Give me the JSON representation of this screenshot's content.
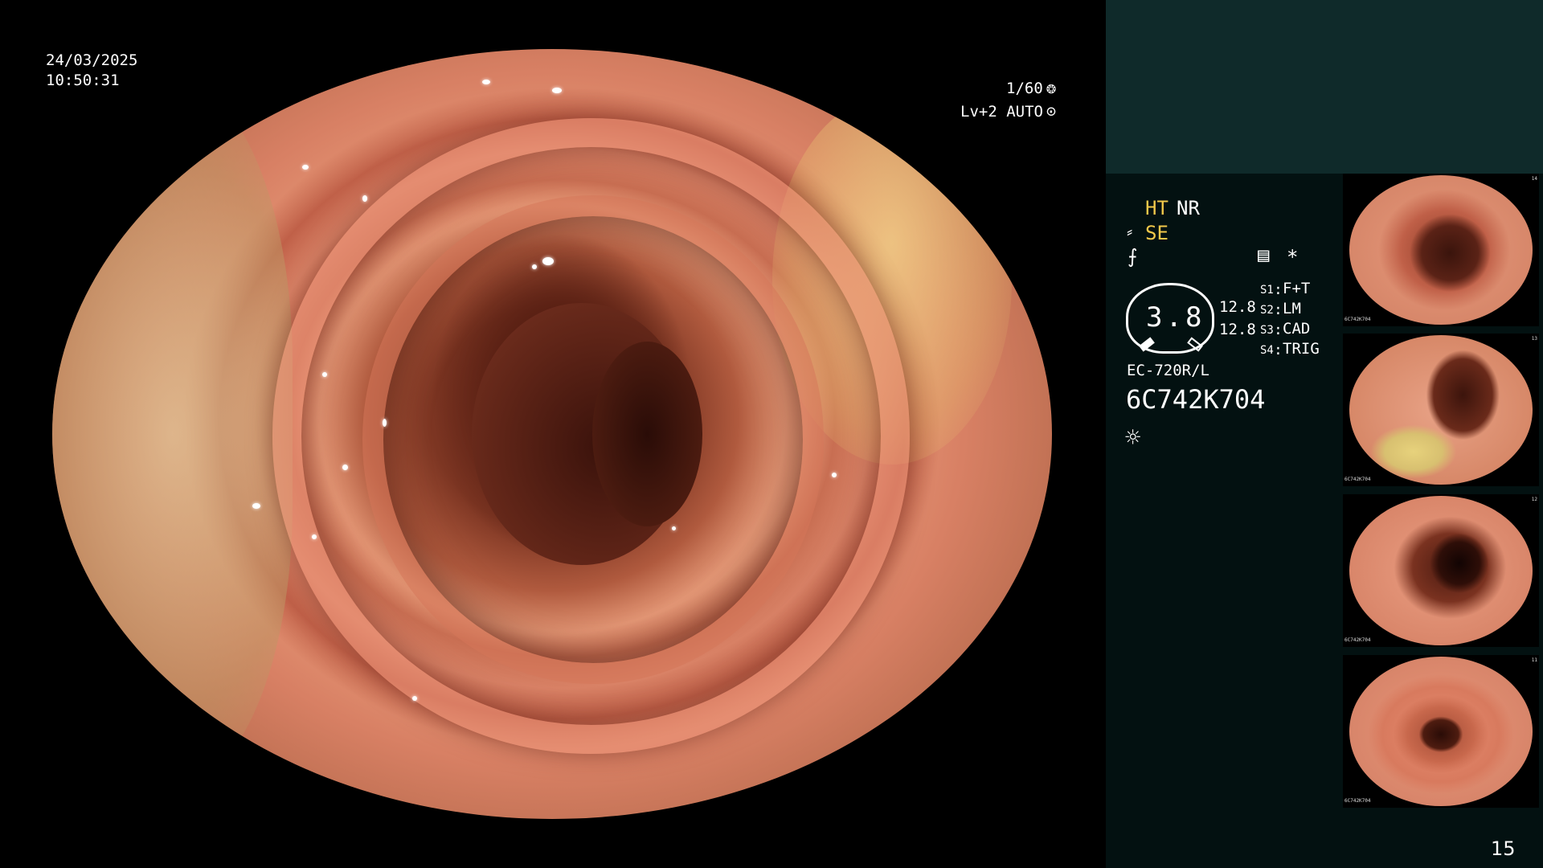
{
  "overlay": {
    "date": "24/03/2025",
    "time": "10:50:31",
    "shutter": "1/60",
    "shutter_icon": "❂",
    "level": "Lv+2 AUTO",
    "auto_icon": "⊙"
  },
  "status": {
    "ht": "HT",
    "nr": "NR",
    "se_icon": "⸗",
    "se": "SE",
    "f_icon": "⨍",
    "memo_icon": "▤",
    "asterisk": "*",
    "gauge_value": "3.8",
    "value_a": "12.8",
    "value_b": "12.8",
    "switches": [
      {
        "key": "S1",
        "value": "F+T"
      },
      {
        "key": "S2",
        "value": "LM"
      },
      {
        "key": "S3",
        "value": "CAD"
      },
      {
        "key": "S4",
        "value": "TRIG"
      }
    ],
    "scope_model": "EC-720R/L",
    "scope_serial": "6C742K704",
    "light_icon": "☼"
  },
  "thumbnails": [
    {
      "serial": "6C742K704",
      "index": "14"
    },
    {
      "serial": "6C742K704",
      "index": "13"
    },
    {
      "serial": "6C742K704",
      "index": "12"
    },
    {
      "serial": "6C742K704",
      "index": "11"
    }
  ],
  "page_number": "15"
}
